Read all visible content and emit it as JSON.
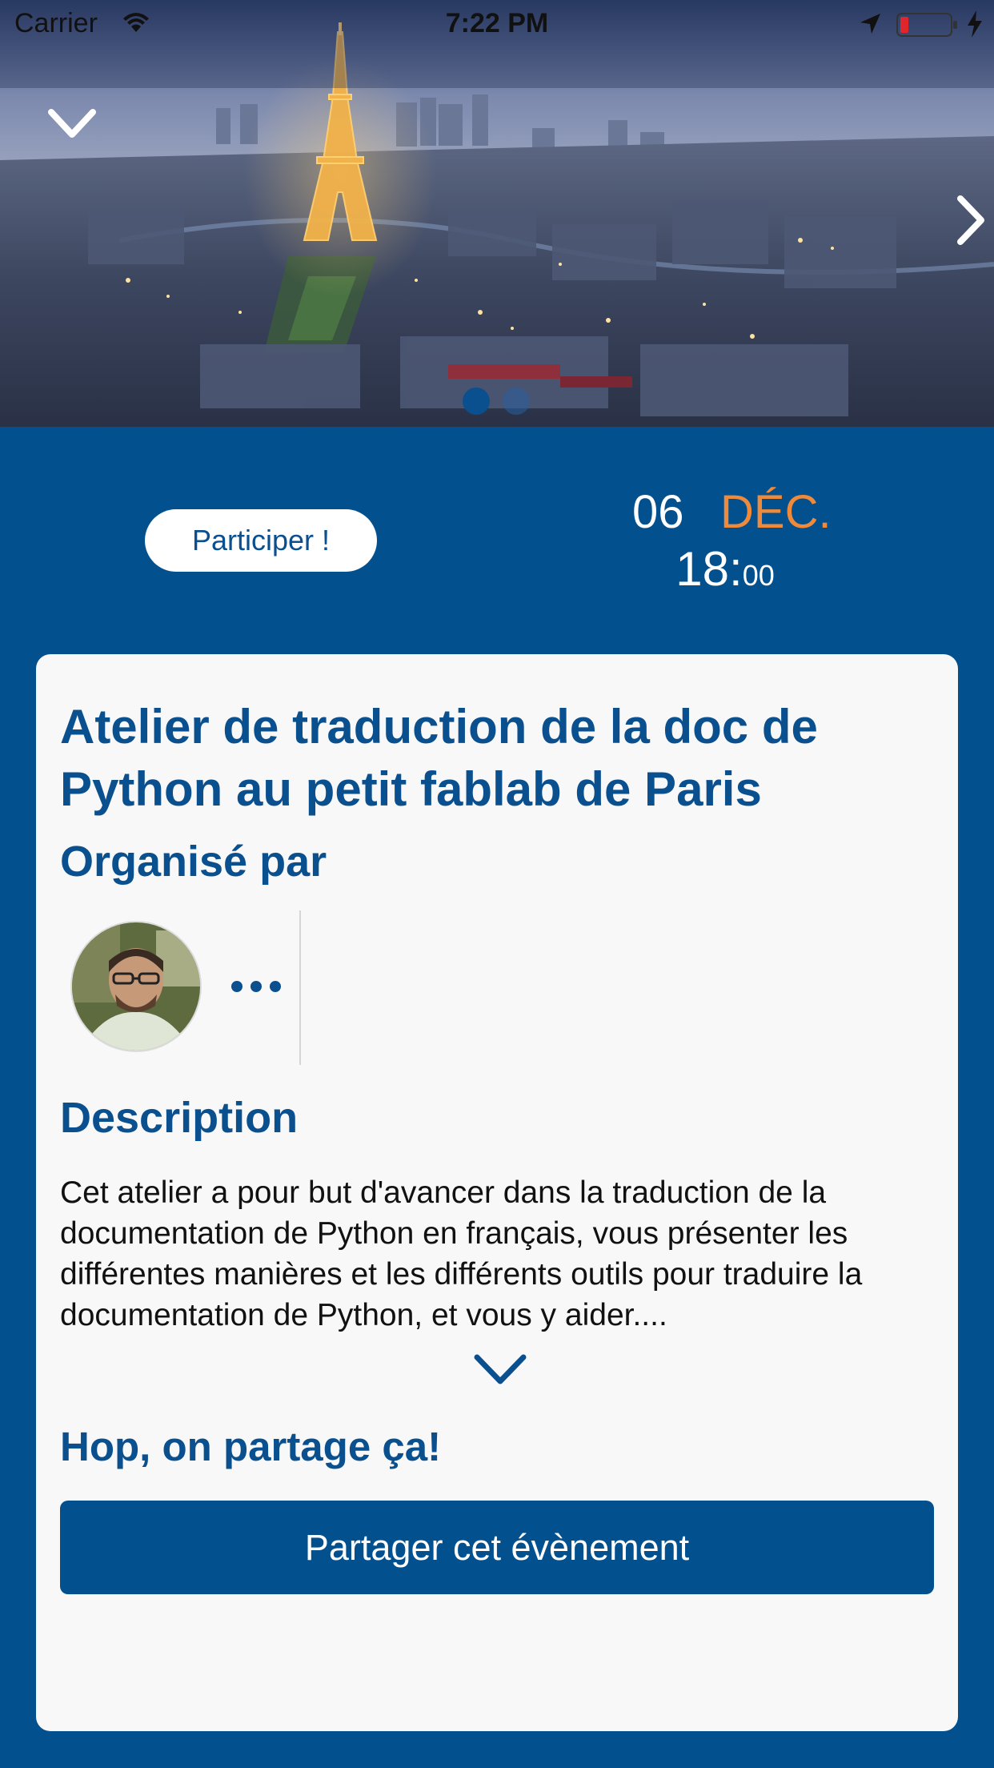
{
  "status_bar": {
    "carrier": "Carrier",
    "time": "7:22 PM"
  },
  "hero": {
    "pages": 2,
    "current_page": 1
  },
  "event": {
    "participate_label": "Participer !",
    "day": "06",
    "month": "DÉC.",
    "hour": "18:",
    "minute": "00",
    "title": "Atelier de traduction de la doc de Python au petit fablab de Paris"
  },
  "organizers": {
    "heading": "Organisé par"
  },
  "description": {
    "heading": "Description",
    "text": "Cet atelier a pour but d'avancer dans la traduction de la documentation de Python en français, vous présenter les différentes manières et les différents outils pour traduire la documentation de Python, et vous y aider...."
  },
  "share": {
    "heading": "Hop, on partage ça!",
    "button_label": "Partager cet évènement"
  },
  "colors": {
    "primary": "#03508f",
    "accent": "#ef8a3a",
    "card": "#f8f8f8"
  }
}
